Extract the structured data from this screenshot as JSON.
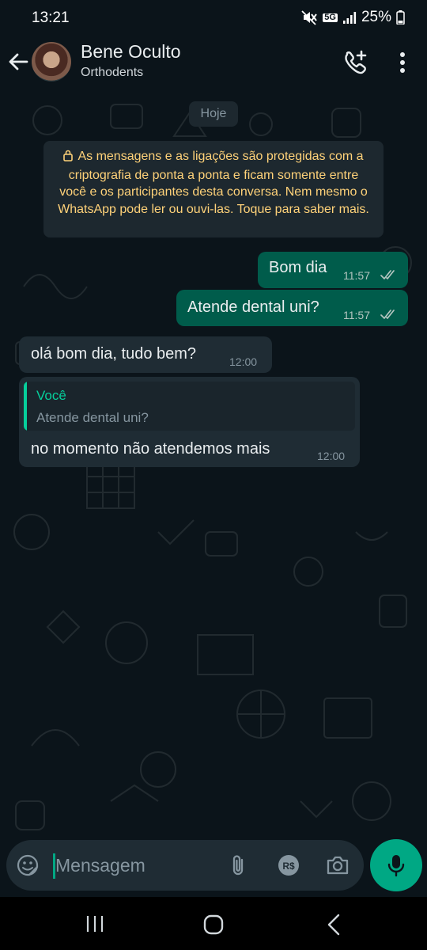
{
  "status_bar": {
    "time": "13:21",
    "network": "5G",
    "battery": "25%",
    "icons": [
      "mute-icon",
      "network-5g-icon",
      "signal-icon",
      "battery-icon"
    ]
  },
  "header": {
    "contact_name": "Bene Oculto",
    "contact_subtitle": "Orthodents",
    "icons": [
      "back-arrow-icon",
      "add-call-icon",
      "more-vert-icon"
    ]
  },
  "chat": {
    "day_label": "Hoje",
    "encryption_notice": "As mensagens e as ligações são protegidas com a criptografia de ponta a ponta e ficam somente entre você e os participantes desta conversa. Nem mesmo o WhatsApp pode ler ou ouvi-las. Toque para saber mais.",
    "messages": [
      {
        "direction": "outgoing",
        "text": "Bom dia",
        "time": "11:57",
        "status": "read"
      },
      {
        "direction": "outgoing",
        "text": "Atende dental uni?",
        "time": "11:57",
        "status": "read"
      },
      {
        "direction": "incoming",
        "text": "olá bom dia, tudo bem?",
        "time": "12:00"
      },
      {
        "direction": "incoming",
        "quote": {
          "author": "Você",
          "text": "Atende dental uni?"
        },
        "text": "no momento não atendemos mais",
        "time": "12:00"
      }
    ]
  },
  "composer": {
    "placeholder": "Mensagem",
    "value": "",
    "icons": [
      "sticker-icon",
      "attach-icon",
      "payment-icon",
      "camera-icon",
      "mic-icon"
    ]
  },
  "colors": {
    "background": "#0b141a",
    "outgoing_bubble": "#005c4b",
    "incoming_bubble": "#1f2c34",
    "accent": "#00a884",
    "read_ticks": "#b4c5c0",
    "notice_text": "#ffd279"
  },
  "navigation_bar": {
    "icons": [
      "recent-apps-icon",
      "home-icon",
      "back-icon"
    ]
  }
}
